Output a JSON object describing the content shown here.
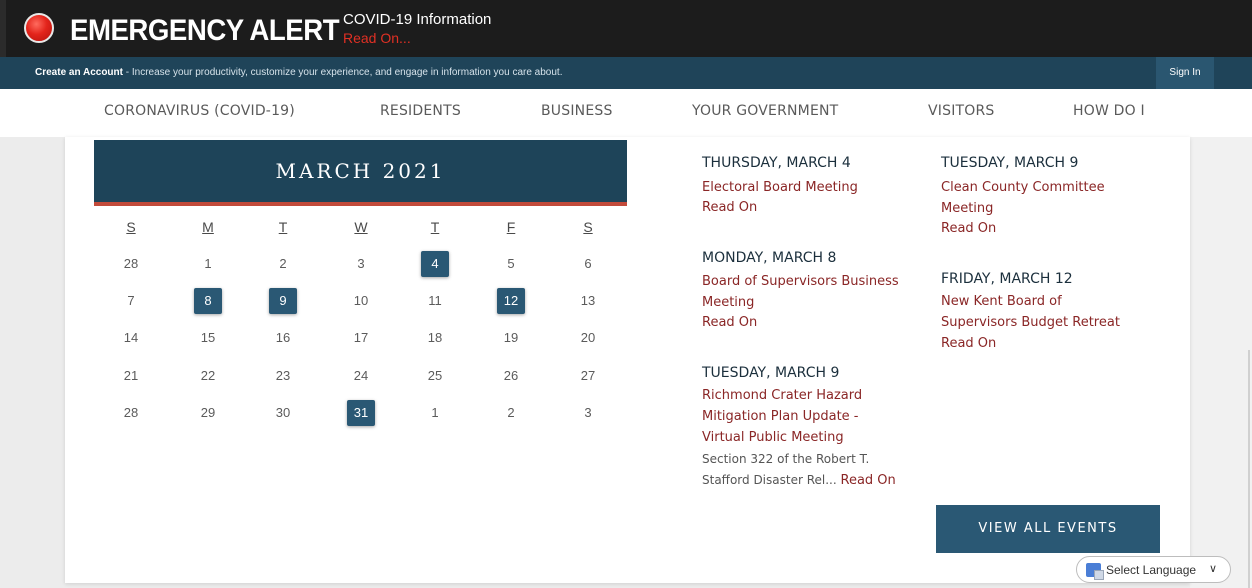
{
  "alert": {
    "title": "EMERGENCY ALERT",
    "info": "COVID-19 Information",
    "read_on": "Read On..."
  },
  "account_bar": {
    "create_link": "Create an Account",
    "tagline": " - Increase your productivity, customize your experience, and engage in information you care about.",
    "sign_in": "Sign In"
  },
  "nav": [
    {
      "label": "CORONAVIRUS (COVID-19)"
    },
    {
      "label": "RESIDENTS"
    },
    {
      "label": "BUSINESS"
    },
    {
      "label": "YOUR GOVERNMENT"
    },
    {
      "label": "VISITORS"
    },
    {
      "label": "HOW DO I"
    }
  ],
  "calendar": {
    "title": "MARCH 2021",
    "weekdays": [
      "S",
      "M",
      "T",
      "W",
      "T",
      "F",
      "S"
    ],
    "weeks": [
      [
        "28",
        "1",
        "2",
        "3",
        "4",
        "5",
        "6"
      ],
      [
        "7",
        "8",
        "9",
        "10",
        "11",
        "12",
        "13"
      ],
      [
        "14",
        "15",
        "16",
        "17",
        "18",
        "19",
        "20"
      ],
      [
        "21",
        "22",
        "23",
        "24",
        "25",
        "26",
        "27"
      ],
      [
        "28",
        "29",
        "30",
        "31",
        "1",
        "2",
        "3"
      ]
    ],
    "event_days": [
      "4",
      "8",
      "9",
      "12",
      "31"
    ]
  },
  "events": [
    {
      "date": "THURSDAY, MARCH 4",
      "title": "Electoral Board Meeting",
      "read": "Read On"
    },
    {
      "date": "MONDAY, MARCH 8",
      "title_lines": [
        "Board of Supervisors Business",
        "Meeting"
      ],
      "read": "Read On"
    },
    {
      "date": "TUESDAY, MARCH 9",
      "title_lines": [
        "Richmond Crater Hazard",
        "Mitigation Plan Update -",
        "Virtual Public Meeting"
      ],
      "desc_lines": [
        "Section 322 of the Robert T.",
        "Stafford Disaster Rel..."
      ],
      "read": "Read On"
    },
    {
      "date": "TUESDAY, MARCH 9",
      "title_lines": [
        "Clean County Committee",
        "Meeting"
      ],
      "read": "Read On"
    },
    {
      "date": "FRIDAY, MARCH 12",
      "title_lines": [
        "New Kent Board of",
        "Supervisors Budget Retreat"
      ],
      "read": "Read On"
    }
  ],
  "view_all": "VIEW ALL EVENTS",
  "language": {
    "label": "Select Language"
  },
  "colors": {
    "header_dark": "#1c1c1c",
    "account_bar": "#1f4459",
    "calendar_header": "#1e4459",
    "accent_red": "#c24a3a",
    "event_link": "#8a2626",
    "button": "#2a5874"
  }
}
